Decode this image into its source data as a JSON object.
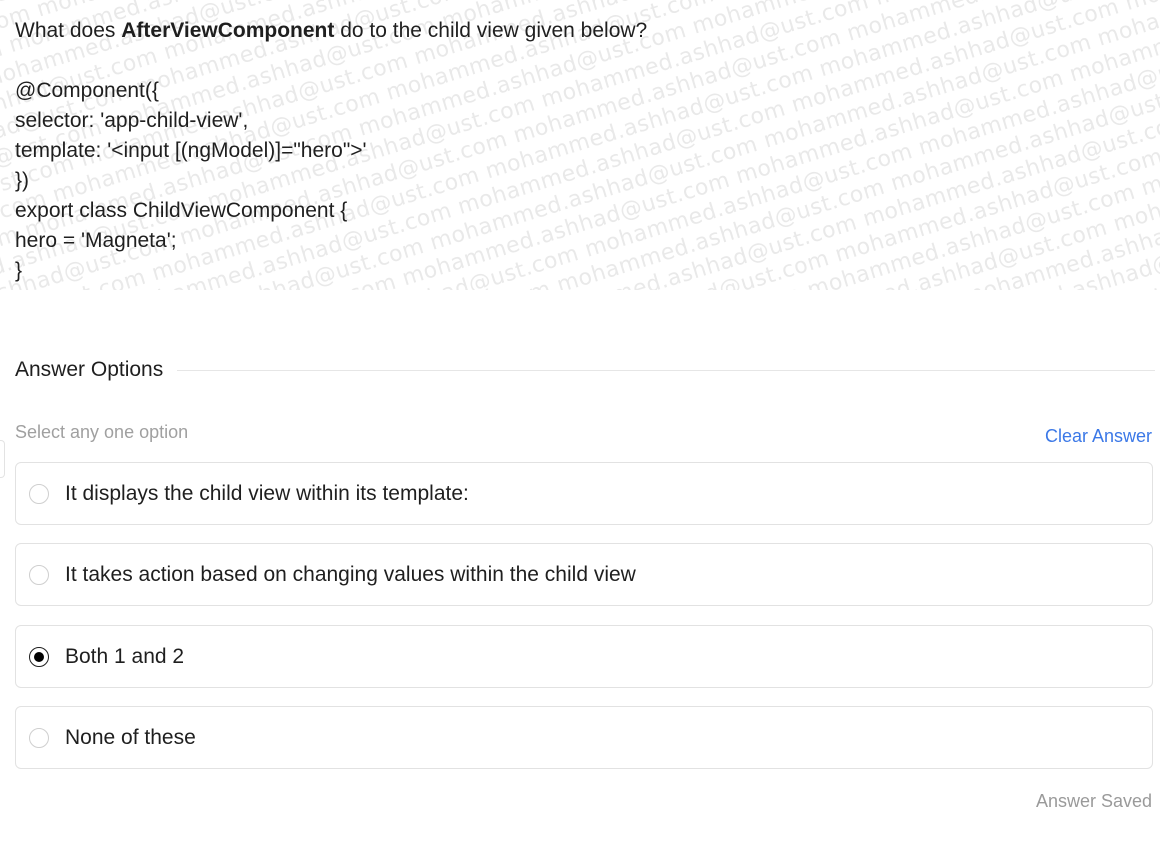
{
  "question": {
    "prefix": "What does ",
    "bold": "AfterViewComponent",
    "suffix": " do to the child view given below?",
    "code_lines": [
      "@Component({",
      "selector: 'app-child-view',",
      "template: '<input [(ngModel)]=\"hero\">'",
      "})",
      "export class ChildViewComponent {",
      "hero = 'Magneta';",
      "}"
    ],
    "watermark_text": "mohammed.ashhad@ust.com"
  },
  "answers": {
    "title": "Answer Options",
    "hint": "Select any one option",
    "clear_label": "Clear Answer",
    "options": [
      {
        "label": "It displays the child view within its template:",
        "selected": false
      },
      {
        "label": "It takes action based on changing values within the child view",
        "selected": false
      },
      {
        "label": "Both 1 and 2",
        "selected": true
      },
      {
        "label": "None of these",
        "selected": false
      }
    ],
    "status": "Answer Saved"
  },
  "colors": {
    "accent": "#3b78e7",
    "selected_radio": "#000000",
    "muted_text": "#a0a0a0"
  }
}
